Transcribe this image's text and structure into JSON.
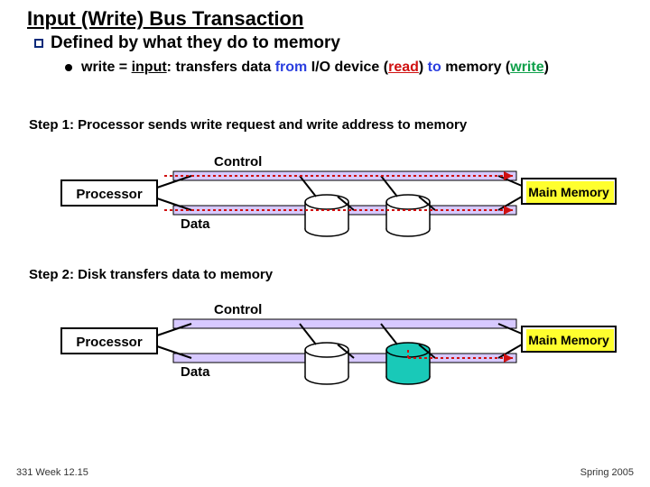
{
  "title": "Input (Write) Bus Transaction",
  "subheading": "Defined by what they do to memory",
  "bullet": {
    "part1": "write = ",
    "input": "input",
    "part2": ": transfers data ",
    "from": "from",
    "part3": " I/O device (",
    "read": "read",
    "part4": ") ",
    "to": "to",
    "part5": " memory (",
    "write": "write",
    "part6": ")"
  },
  "step1": "Step 1: Processor sends write request and write address to memory",
  "step2": "Step 2: Disk transfers data to memory",
  "labels": {
    "processor": "Processor",
    "control": "Control",
    "data": "Data",
    "memory": "Main Memory"
  },
  "footer": {
    "left": "331 Week 12.15",
    "right": "Spring 2005"
  },
  "colors": {
    "highlight": "#ffff2e",
    "teal": "#19c9b8",
    "lavender": "#d7c9ff"
  }
}
